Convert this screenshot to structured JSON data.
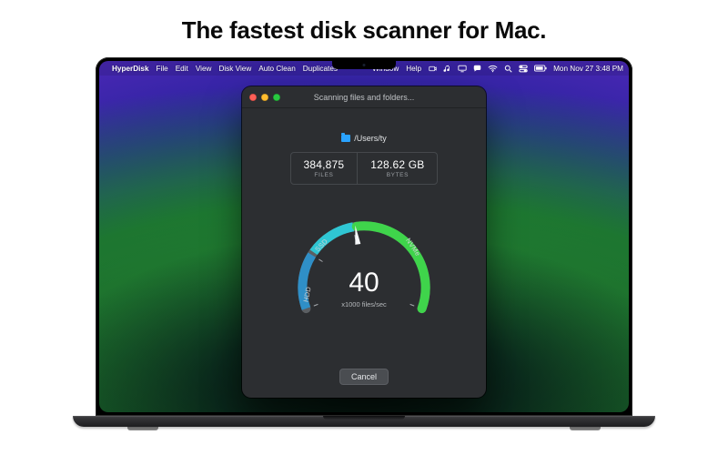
{
  "marketing": {
    "headline": "The fastest disk scanner for Mac."
  },
  "menubar": {
    "app_name": "HyperDisk",
    "items": [
      "File",
      "Edit",
      "View",
      "Disk View",
      "Auto Clean",
      "Duplicates"
    ],
    "right_items": [
      "Window",
      "Help"
    ],
    "datetime": "Mon Nov 27  3:48 PM"
  },
  "window": {
    "title": "Scanning files and folders...",
    "path": "/Users/ty",
    "stats": {
      "files_value": "384,875",
      "files_label": "FILES",
      "bytes_value": "128.62 GB",
      "bytes_label": "BYTES"
    },
    "gauge": {
      "value": "40",
      "unit_label": "x1000 files/sec",
      "seg_labels": [
        "HDD",
        "SSD",
        "NVMe"
      ],
      "colors": {
        "hdd": "#2f8fc7",
        "ssd": "#2fc6d3",
        "nvme": "#3fd44b",
        "needle": "#f6f8f9",
        "track": "#5b5f63"
      }
    },
    "cancel_label": "Cancel"
  },
  "icons": [
    "camera-icon",
    "music-icon",
    "screen-icon",
    "chat-icon",
    "wifi-icon",
    "search-icon",
    "control-center-icon",
    "battery-icon"
  ]
}
